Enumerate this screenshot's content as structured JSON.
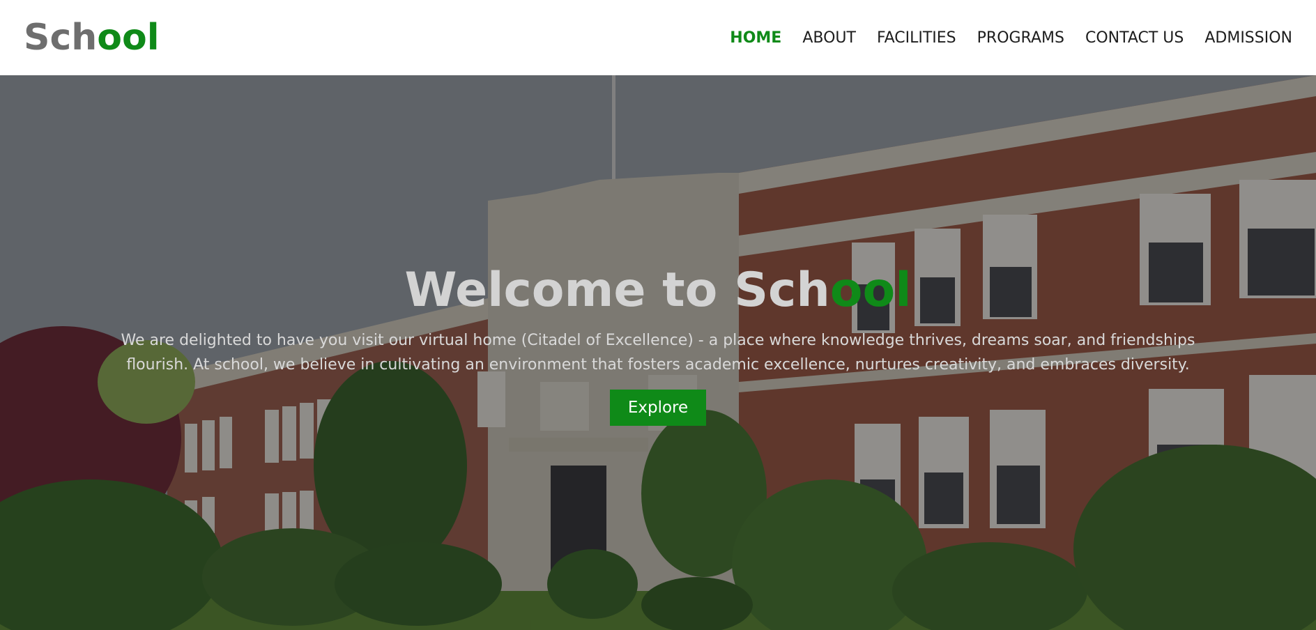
{
  "brand": {
    "logo_part1": "Sch",
    "logo_part2": "ool"
  },
  "nav": {
    "items": [
      {
        "label": "HOME",
        "active": true
      },
      {
        "label": "ABOUT"
      },
      {
        "label": "FACILITIES"
      },
      {
        "label": "PROGRAMS"
      },
      {
        "label": "CONTACT US"
      },
      {
        "label": "ADMISSION"
      }
    ]
  },
  "hero": {
    "title_part1": "Welcome to Sch",
    "title_part2": "ool",
    "description": "We are delighted to have you visit our virtual home (Citadel of Excellence) - a place where knowledge thrives, dreams soar, and friendships flourish. At school, we believe in cultivating an environment that fosters academic excellence, nurtures creativity, and embraces diversity.",
    "cta_label": "Explore"
  },
  "colors": {
    "accent": "#0f8a18",
    "logo_gray": "#6e6e6e",
    "nav_text": "#1d1d1d"
  }
}
